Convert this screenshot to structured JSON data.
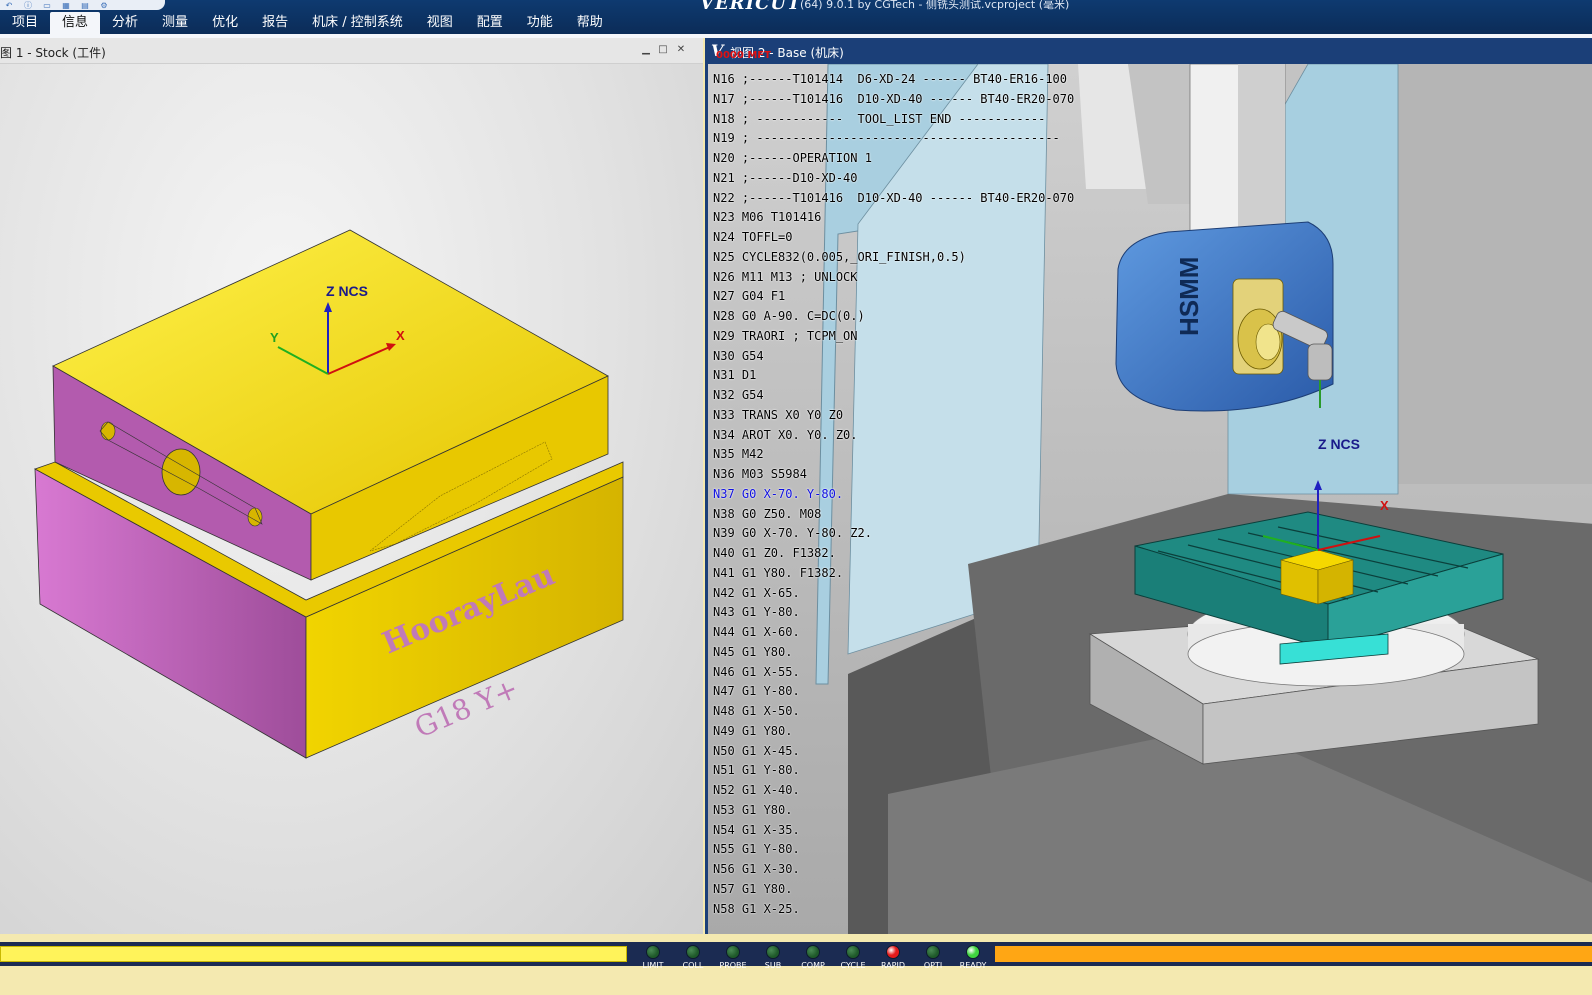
{
  "app": {
    "name": "VERICUT",
    "document_title": "(64)  9.0.1 by CGTech - 侧铣头测试.vcproject (毫米)"
  },
  "menu": [
    "项目",
    "信息",
    "分析",
    "测量",
    "优化",
    "报告",
    "机床 / 控制系统",
    "视图",
    "配置",
    "功能",
    "帮助"
  ],
  "menu_active_index": 1,
  "left_view": {
    "title": "图 1 - Stock (工件)",
    "axis_title": "Z NCS",
    "axis_x": "X",
    "axis_y": "Y",
    "engraving_1": "HoorayLau",
    "engraving_2": "G18  Y+"
  },
  "right_view": {
    "title": "视图 2 - Base (机床)",
    "logo": "V",
    "badge": "0000 MFT",
    "axis_title": "Z NCS",
    "axis_x": "X",
    "spindle_brand": "HSMM",
    "current_line_index": 21,
    "nc_lines": [
      "N16 ;------T101414  D6-XD-24 ------ BT40-ER16-100",
      "N17 ;------T101416  D10-XD-40 ------ BT40-ER20-070",
      "N18 ; ------------  TOOL_LIST END ------------",
      "N19 ; ------------------------------------------",
      "N20 ;------OPERATION 1",
      "N21 ;------D10-XD-40",
      "N22 ;------T101416  D10-XD-40 ------ BT40-ER20-070",
      "N23 M06 T101416",
      "N24 TOFFL=0",
      "N25 CYCLE832(0.005,_ORI_FINISH,0.5)",
      "N26 M11 M13 ; UNLOCK",
      "N27 G04 F1",
      "N28 G0 A-90. C=DC(0.)",
      "N29 TRAORI ; TCPM_ON",
      "N30 G54",
      "N31 D1",
      "N32 G54",
      "N33 TRANS X0 Y0 Z0",
      "N34 AROT X0. Y0. Z0.",
      "N35 M42",
      "N36 M03 S5984",
      "N37 G0 X-70. Y-80.",
      "N38 G0 Z50. M08",
      "N39 G0 X-70. Y-80. Z2.",
      "N40 G1 Z0. F1382.",
      "N41 G1 Y80. F1382.",
      "N42 G1 X-65.",
      "N43 G1 Y-80.",
      "N44 G1 X-60.",
      "N45 G1 Y80.",
      "N46 G1 X-55.",
      "N47 G1 Y-80.",
      "N48 G1 X-50.",
      "N49 G1 Y80.",
      "N50 G1 X-45.",
      "N51 G1 Y-80.",
      "N52 G1 X-40.",
      "N53 G1 Y80.",
      "N54 G1 X-35.",
      "N55 G1 Y-80.",
      "N56 G1 X-30.",
      "N57 G1 Y80.",
      "N58 G1 X-25."
    ]
  },
  "status": {
    "indicators": [
      {
        "label": "LIMIT",
        "state": "off",
        "color": "#1f5a2a"
      },
      {
        "label": "COLL",
        "state": "off",
        "color": "#1f5a2a"
      },
      {
        "label": "PROBE",
        "state": "off",
        "color": "#1f5a2a"
      },
      {
        "label": "SUB",
        "state": "off",
        "color": "#1f5a2a"
      },
      {
        "label": "COMP",
        "state": "off",
        "color": "#1f5a2a"
      },
      {
        "label": "CYCLE",
        "state": "off",
        "color": "#1f5a2a"
      },
      {
        "label": "RAPID",
        "state": "on",
        "color": "#e51a1a"
      },
      {
        "label": "OPTI",
        "state": "off",
        "color": "#1f5a2a"
      },
      {
        "label": "READY",
        "state": "on",
        "color": "#3fd43f"
      }
    ],
    "colors": {
      "progress": "#fff35a",
      "remaining": "#ffa614",
      "strip": "#1b2b52"
    }
  }
}
